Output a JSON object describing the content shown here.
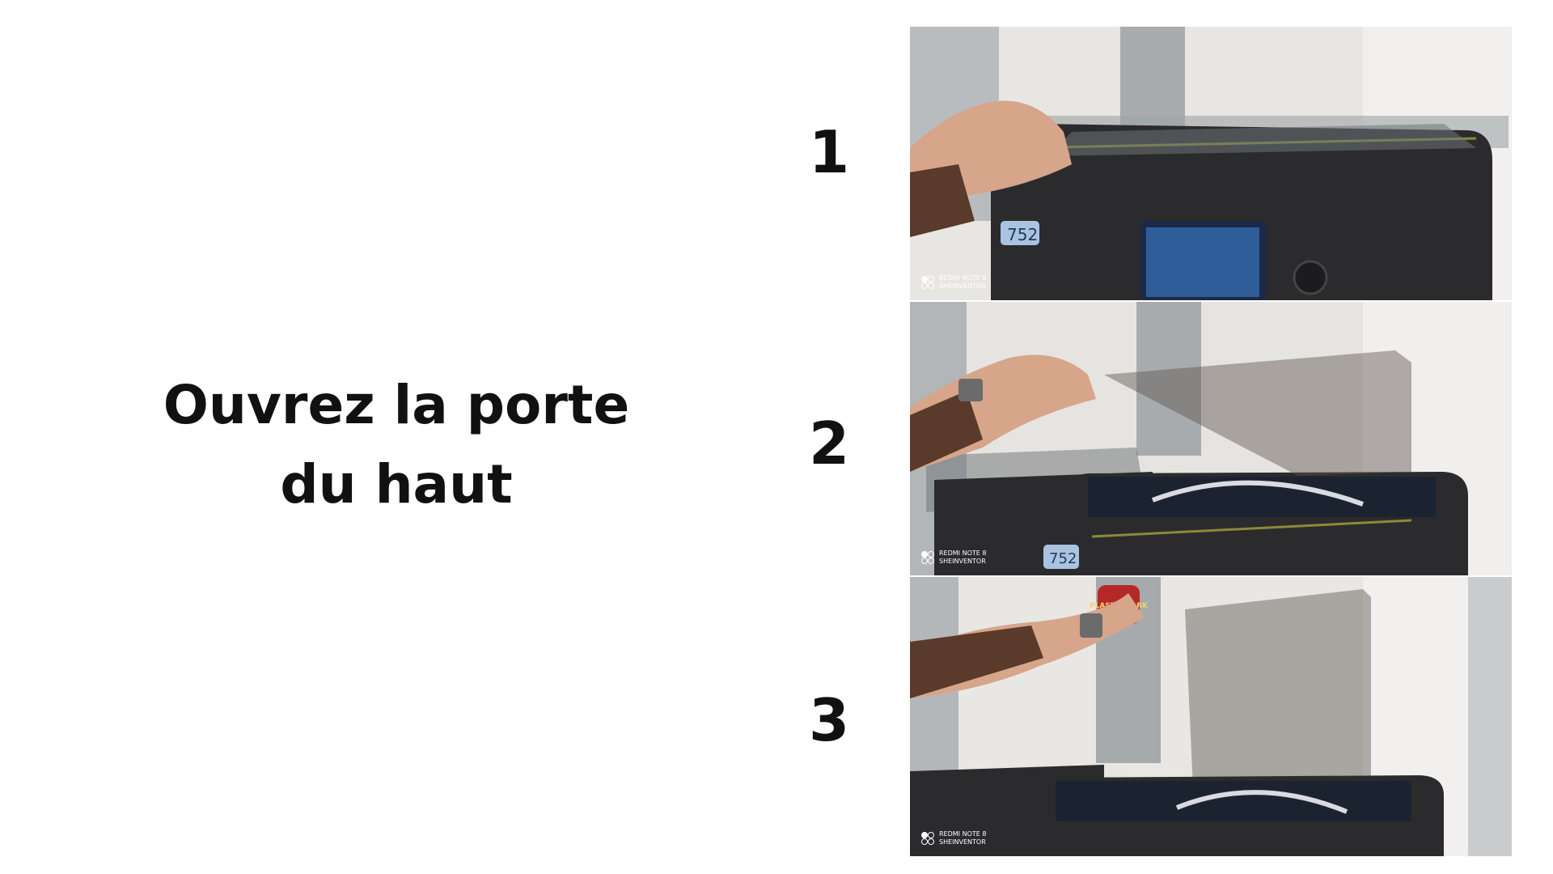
{
  "title_lines": [
    "Ouvrez la porte",
    "du haut"
  ],
  "steps": [
    {
      "number": "1",
      "photo": {
        "subject": "hand-lifting-closed-top-door",
        "display_value": "752",
        "watermark": [
          "REDMI NOTE 8",
          "SHEINVENTOR"
        ]
      }
    },
    {
      "number": "2",
      "photo": {
        "subject": "hand-lifting-half-open-top-door",
        "display_value": "752",
        "watermark": [
          "REDMI NOTE 8",
          "SHEINVENTOR"
        ]
      }
    },
    {
      "number": "3",
      "photo": {
        "subject": "hand-holding-fully-open-top-door",
        "poster_text": "PLASTIK PARK",
        "watermark": [
          "REDMI NOTE 8",
          "SHEINVENTOR"
        ]
      }
    }
  ],
  "colors": {
    "text": "#111111",
    "background": "#ffffff",
    "printer_body": "#2b2b2d",
    "accent_line": "#8a8a3a"
  }
}
